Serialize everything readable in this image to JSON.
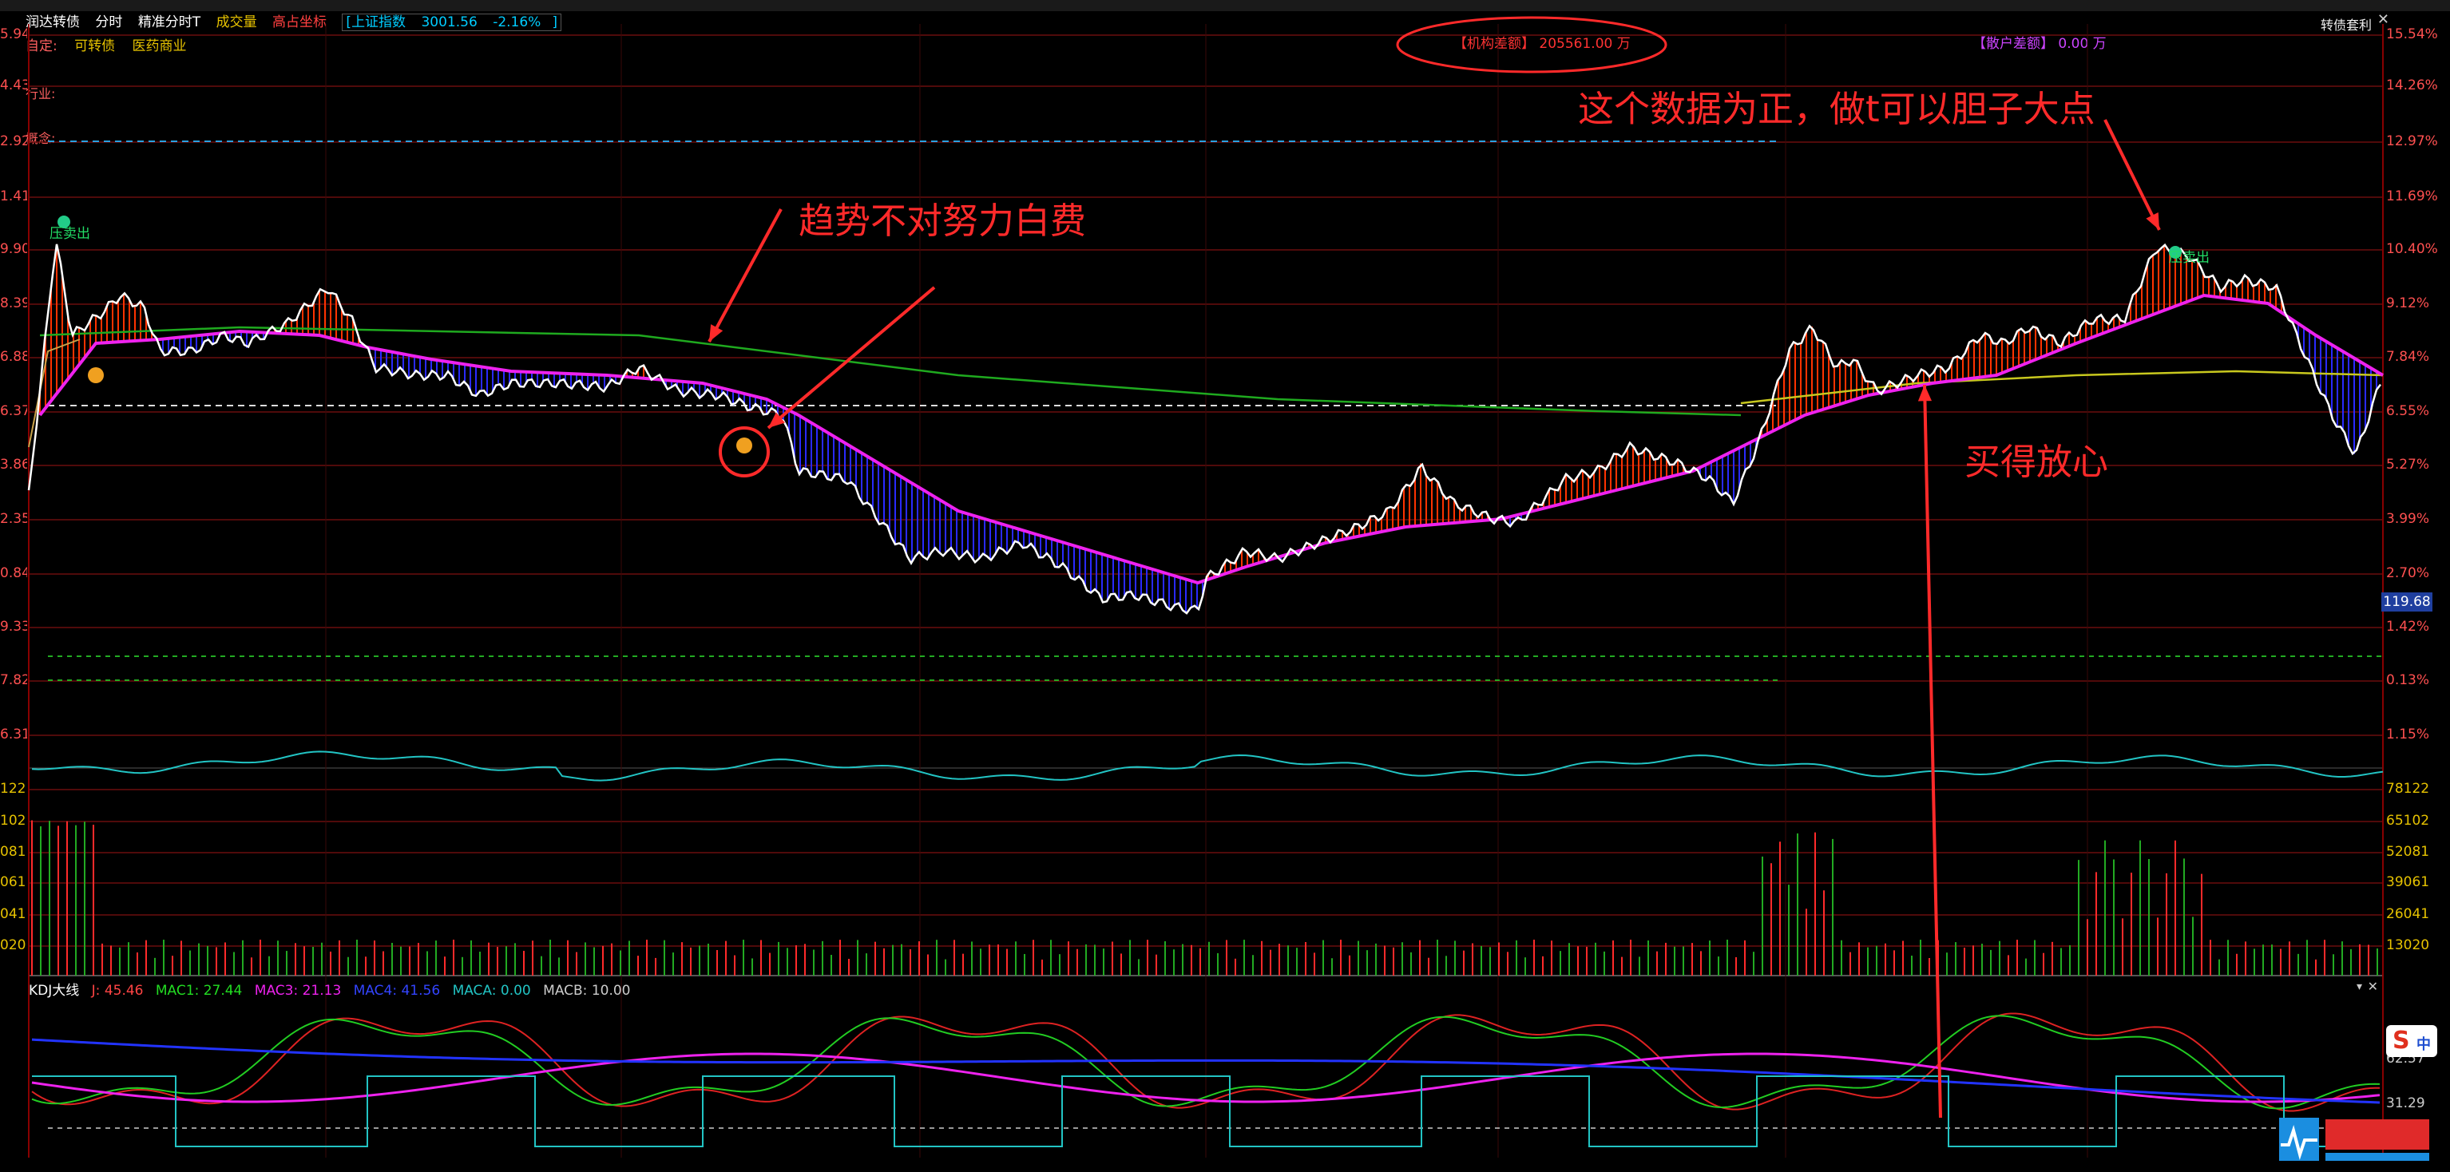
{
  "app": {
    "stock_name": "润达转债",
    "mode": "分时",
    "precise_mode": "精准分时T",
    "volume_label": "成交量",
    "highlight_label": "高占坐标",
    "index_name": "上证指数",
    "index_value": "3001.56",
    "index_change": "-2.16%",
    "custom_label": "自定:",
    "custom_tags": [
      "可转债",
      "医药商业"
    ],
    "industry_label": "行业:",
    "concept_label": "概念:",
    "corner_button": "转债套利",
    "close_glyph": "✕"
  },
  "metrics": {
    "institution_label": "【机构差额】",
    "institution_value": "205561.00 万",
    "retail_label": "【散户差额】",
    "retail_value": "0.00 万"
  },
  "annotations": {
    "trend": "趋势不对努力白费",
    "data_positive": "这个数据为正，做t可以胆子大点",
    "buy": "买得放心"
  },
  "markers": {
    "sell_left": "压卖出",
    "sell_right": "压卖出"
  },
  "price_axis": {
    "left": [
      "5.94",
      "4.43",
      "2.92",
      "1.41",
      "9.90",
      "8.39",
      "6.88",
      "6.37",
      "3.86",
      "2.35",
      "0.84",
      "9.33",
      "7.82",
      "6.31"
    ],
    "right": [
      "15.54%",
      "14.26%",
      "12.97%",
      "11.69%",
      "10.40%",
      "9.12%",
      "7.84%",
      "6.55%",
      "5.27%",
      "3.99%",
      "2.70%",
      "1.42%",
      "0.13%",
      "1.15%"
    ],
    "current_price": "119.68"
  },
  "volume_axis": {
    "left": [
      "122",
      "102",
      "081",
      "061",
      "041",
      "020"
    ],
    "right": [
      "78122",
      "65102",
      "52081",
      "39061",
      "26041",
      "13020"
    ]
  },
  "kdj": {
    "title": "KDJ大线",
    "j_label": "J: 45.46",
    "mac1": "MAC1: 27.44",
    "mac3": "MAC3: 21.13",
    "mac4": "MAC4: 41.56",
    "maca": "MACA: 0.00",
    "macb": "MACB: 10.00",
    "axis_right": [
      "62.57",
      "31.29"
    ],
    "dropdown": "▾",
    "close": "✕"
  },
  "colors": {
    "bg": "#000000",
    "grid": "#6a0d0d",
    "price": "#ffffff",
    "avg": "#ee22ee",
    "ma_green": "#1faa1f",
    "ma_yellow": "#c8c81e",
    "up_fill": "#ff3300",
    "down_fill": "#2a2aff",
    "annotation": "#ff2a2a",
    "cyan": "#22c4c4"
  }
}
